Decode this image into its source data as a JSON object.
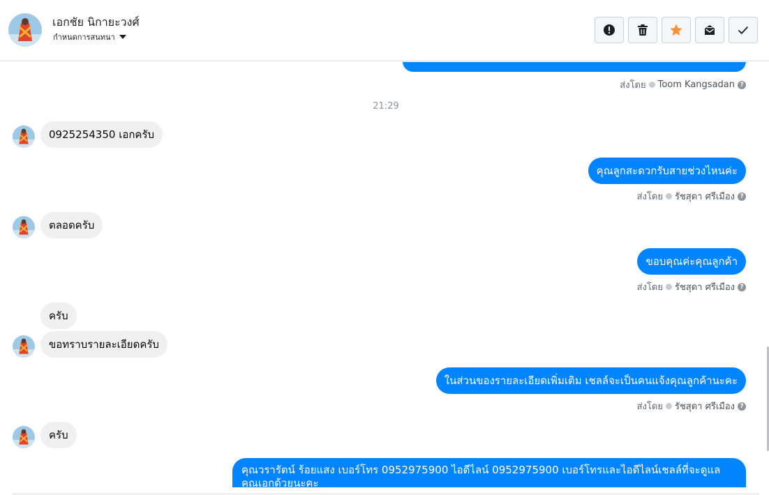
{
  "header": {
    "contact_name": "เอกชัย นิกายะวงศ์",
    "assign_label": "กำหนดการสนทนา",
    "actions": [
      {
        "name": "mark-spam-button",
        "icon": "exclamation-icon"
      },
      {
        "name": "delete-button",
        "icon": "trash-icon"
      },
      {
        "name": "star-button",
        "icon": "star-icon"
      },
      {
        "name": "mark-unread-button",
        "icon": "envelope-icon"
      },
      {
        "name": "mark-done-button",
        "icon": "check-icon"
      }
    ]
  },
  "colors": {
    "outgoing_bubble": "#0084ff",
    "incoming_bubble": "#f0f0f0",
    "star": "#f7923a"
  },
  "conversation": {
    "sent_by_prefix": "ส่งโดย",
    "help_glyph": "?",
    "timestamp": "21:29",
    "top_sent_by_name": "Toom Kangsadan",
    "messages": [
      {
        "direction": "in",
        "text": "0925254350 เอกครับ"
      },
      {
        "direction": "out",
        "text": "คุณลูกสะดวกรับสายช่วงไหนค่ะ",
        "sent_by": "รัชสุดา ศรีเมือง"
      },
      {
        "direction": "in",
        "text": "ตลอดครับ"
      },
      {
        "direction": "out",
        "text": "ขอบคุณค่ะคุณลูกค้า",
        "sent_by": "รัชสุดา ศรีเมือง"
      },
      {
        "direction": "in",
        "text": "ครับ"
      },
      {
        "direction": "in",
        "text": "ขอทราบรายละเอียดครับ"
      },
      {
        "direction": "out",
        "text": "ในส่วนของรายละเอียดเพิ่มเติม  เชลล์จะเป็นคนแจ้งคุณลูกค้านะคะ",
        "sent_by": "รัชสุดา ศรีเมือง"
      },
      {
        "direction": "in",
        "text": "ครับ"
      },
      {
        "direction": "out",
        "text": "คุณวรารัตน์ ร้อยแสง       เบอร์โทร 0952975900  ไอดีไลน์ 0952975900   เบอร์โทรและไอดีไลน์เชลล์ที่จะดูแลคุณเอกด้วยนะคะ"
      }
    ]
  }
}
